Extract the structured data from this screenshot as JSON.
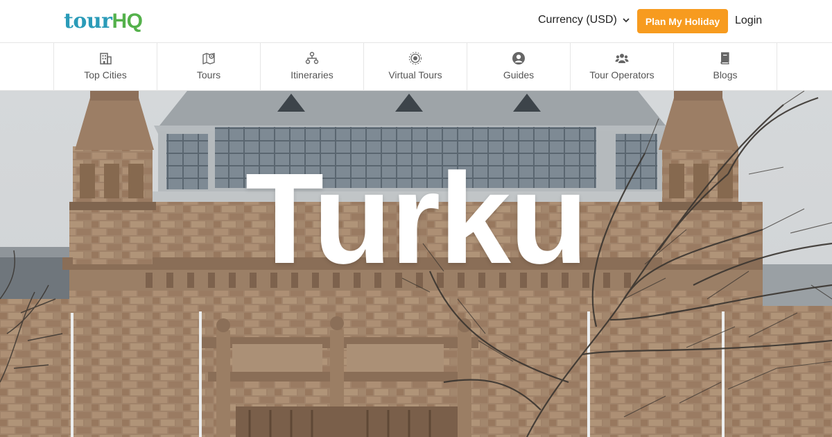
{
  "header": {
    "logo": {
      "part1": "tour",
      "part2": "HQ"
    },
    "currency_label": "Currency (USD)",
    "plan_button": "Plan My Holiday",
    "login_label": "Login"
  },
  "nav": {
    "items": [
      {
        "label": "Top Cities",
        "icon": "building-icon"
      },
      {
        "label": "Tours",
        "icon": "map-pin-icon"
      },
      {
        "label": "Itineraries",
        "icon": "sitemap-icon"
      },
      {
        "label": "Virtual Tours",
        "icon": "virtual-tour-icon"
      },
      {
        "label": "Guides",
        "icon": "user-circle-icon"
      },
      {
        "label": "Tour Operators",
        "icon": "users-icon"
      },
      {
        "label": "Blogs",
        "icon": "book-icon"
      }
    ]
  },
  "hero": {
    "title": "Turku"
  },
  "colors": {
    "accent": "#f79b1f",
    "logo_blue": "#2a9bb8",
    "logo_green": "#54b14b",
    "icon_gray": "#666666"
  }
}
